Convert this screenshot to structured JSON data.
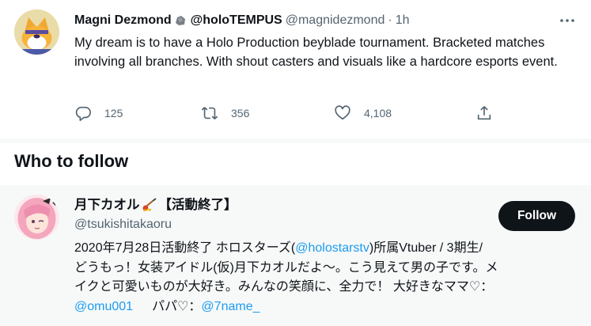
{
  "tweet": {
    "author_name": "Magni Dezmond",
    "handle_display": "@holoTEMPUS",
    "username": "@magnidezmond",
    "separator": "·",
    "time": "1h",
    "text": "My dream is to have a Holo Production beyblade tournament. Bracketed matches involving all branches. With shout casters and visuals like a hardcore esports event.",
    "replies": "125",
    "retweets": "356",
    "likes": "4,108",
    "icons": [
      "reply-icon",
      "retweet-icon",
      "like-icon",
      "share-icon",
      "more-icon"
    ]
  },
  "who_to_follow": {
    "title": "Who to follow",
    "user": {
      "name_part1": "月下カオル",
      "name_part2": "【活動終了】",
      "handle": "@tsukishitakaoru",
      "follow_label": "Follow",
      "bio": {
        "line1_a": "2020年7月28日活動終了 ホロスターズ(",
        "line1_link": "@holostarstv",
        "line1_b": ")所属Vtuber / 3期生/",
        "line2": "どうもっ！女装アイドル(仮)月下カオルだよ〜。こう見えて男の子です。メ",
        "line3": "イクと可愛いものが大好き。みんなの笑顔に、全力で！ 大好きなママ♡：",
        "link_mama": "@omu001",
        "papa_label": "パパ♡：",
        "link_papa": "@7name_"
      }
    }
  },
  "colors": {
    "text": "#0f1419",
    "secondary": "#536471",
    "link": "#1d9bf0",
    "card_bg": "#f7f9f9",
    "button_bg": "#0f1419"
  }
}
